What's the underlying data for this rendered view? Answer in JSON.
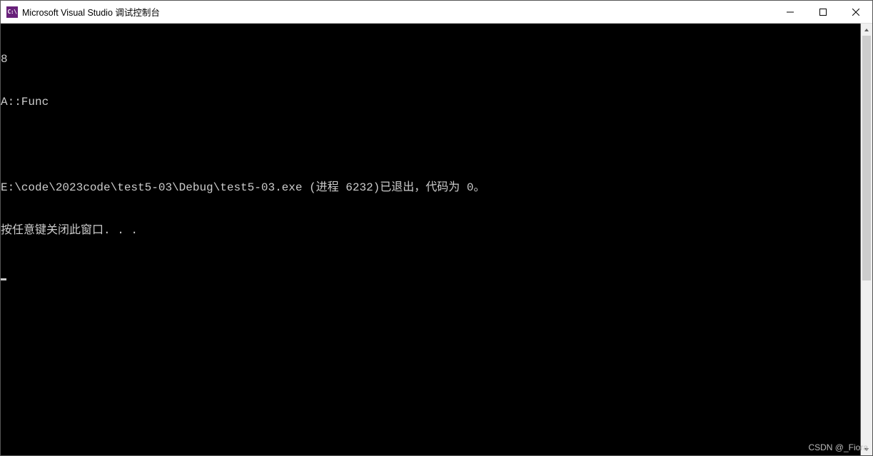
{
  "window": {
    "title": "Microsoft Visual Studio 调试控制台",
    "app_icon_text": "C:\\"
  },
  "console": {
    "lines": [
      "8",
      "A::Func",
      "",
      "E:\\code\\2023code\\test5-03\\Debug\\test5-03.exe (进程 6232)已退出，代码为 0。",
      "按任意键关闭此窗口. . ."
    ]
  },
  "watermark": "CSDN @_Fiora"
}
